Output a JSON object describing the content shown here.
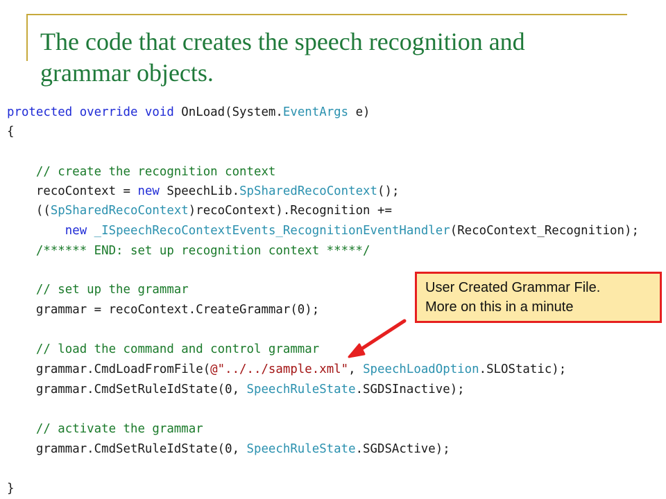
{
  "slide": {
    "title_line1": "The code that creates the speech recognition and",
    "title_line2": "grammar objects."
  },
  "callout": {
    "line1": "User Created Grammar File.",
    "line2": "More on this in a minute"
  },
  "code": {
    "l1_kw": "protected override void",
    "l1_a": " OnLoad(System.",
    "l1_ty": "EventArgs",
    "l1_b": " e)",
    "l2": "{",
    "l3_cm": "    // create the recognition context",
    "l4_a": "    recoContext = ",
    "l4_kw": "new",
    "l4_b": " SpeechLib.",
    "l4_ty": "SpSharedRecoContext",
    "l4_c": "();",
    "l5_a": "    ((",
    "l5_ty": "SpSharedRecoContext",
    "l5_b": ")recoContext).Recognition +=",
    "l6_a": "        ",
    "l6_kw": "new",
    "l6_b": " ",
    "l6_ty": "_ISpeechRecoContextEvents_RecognitionEventHandler",
    "l6_c": "(RecoContext_Recognition);",
    "l7_cm": "    /****** END: set up recognition context *****/",
    "l8_cm": "    // set up the grammar",
    "l9": "    grammar = recoContext.CreateGrammar(0);",
    "l10_cm": "    // load the command and control grammar",
    "l11_a": "    grammar.CmdLoadFromFile(",
    "l11_st": "@\"../../sample.xml\"",
    "l11_b": ", ",
    "l11_ty": "SpeechLoadOption",
    "l11_c": ".SLOStatic);",
    "l12_a": "    grammar.CmdSetRuleIdState(0, ",
    "l12_ty": "SpeechRuleState",
    "l12_b": ".SGDSInactive);",
    "l13_cm": "    // activate the grammar",
    "l14_a": "    grammar.CmdSetRuleIdState(0, ",
    "l14_ty": "SpeechRuleState",
    "l14_b": ".SGDSActive);",
    "l15": "}"
  },
  "colors": {
    "title": "#1f7a3a",
    "rule": "#c6a93b",
    "keyword": "#1f2bd6",
    "type": "#2b91af",
    "comment": "#1a7a2a",
    "string": "#a31515",
    "callout_bg": "#fde9a8",
    "callout_border": "#e62020",
    "arrow": "#e62020"
  }
}
